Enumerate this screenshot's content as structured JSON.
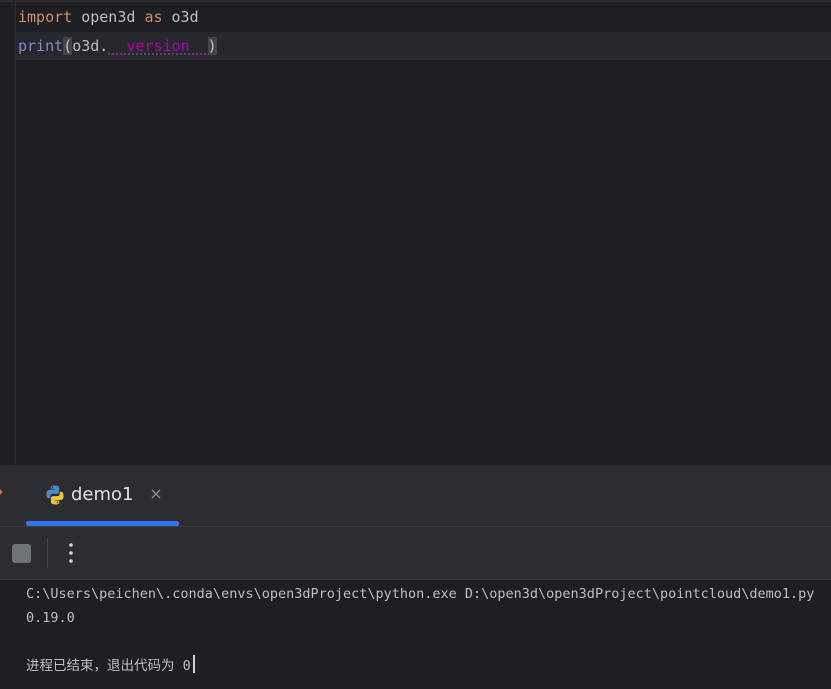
{
  "editor": {
    "line1": {
      "kw_import": "import",
      "module": " open3d ",
      "kw_as": "as",
      "alias": " o3d"
    },
    "line2": {
      "fn": "print",
      "open_paren": "(",
      "obj": "o3d.",
      "attr": "__version__",
      "close_paren": ")"
    }
  },
  "run_panel": {
    "tab": {
      "label": "demo1",
      "icon": "python-icon",
      "close": "×"
    },
    "toolbar": {
      "stop_icon": "stop-icon",
      "more_icon": "more-vertical-icon"
    },
    "console": {
      "command": "C:\\Users\\peichen\\.conda\\envs\\open3dProject\\python.exe D:\\open3d\\open3dProject\\pointcloud\\demo1.py",
      "output": "0.19.0",
      "exit_message": "进程已结束，退出代码为 0"
    }
  },
  "colors": {
    "background": "#1e1f22",
    "keyword": "#cf8e6d",
    "builtin": "#8888c6",
    "dunder": "#b200b2",
    "accent": "#3574f0"
  }
}
